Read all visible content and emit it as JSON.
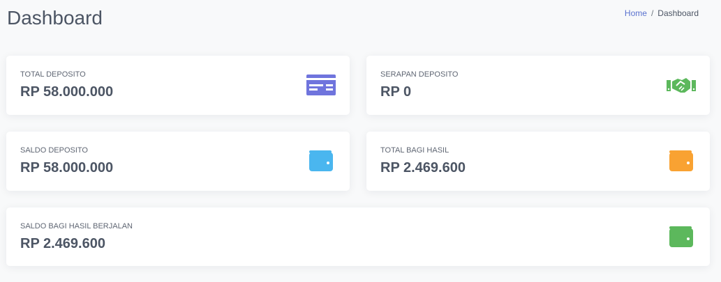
{
  "header": {
    "title": "Dashboard"
  },
  "breadcrumb": {
    "home": "Home",
    "separator": "/",
    "current": "Dashboard"
  },
  "cards": [
    {
      "label": "TOTAL DEPOSITO",
      "value": "RP 58.000.000",
      "icon": "credit-card-icon",
      "color": "#6f74dd"
    },
    {
      "label": "SERAPAN DEPOSITO",
      "value": "RP 0",
      "icon": "handshake-icon",
      "color": "#5cb85c"
    },
    {
      "label": "SALDO DEPOSITO",
      "value": "RP 58.000.000",
      "icon": "wallet-icon",
      "color": "#4ab6ef"
    },
    {
      "label": "TOTAL BAGI HASIL",
      "value": "RP 2.469.600",
      "icon": "wallet-icon",
      "color": "#f9a232"
    },
    {
      "label": "SALDO BAGI HASIL BERJALAN",
      "value": "RP 2.469.600",
      "icon": "wallet-icon",
      "color": "#5cb85c"
    }
  ]
}
